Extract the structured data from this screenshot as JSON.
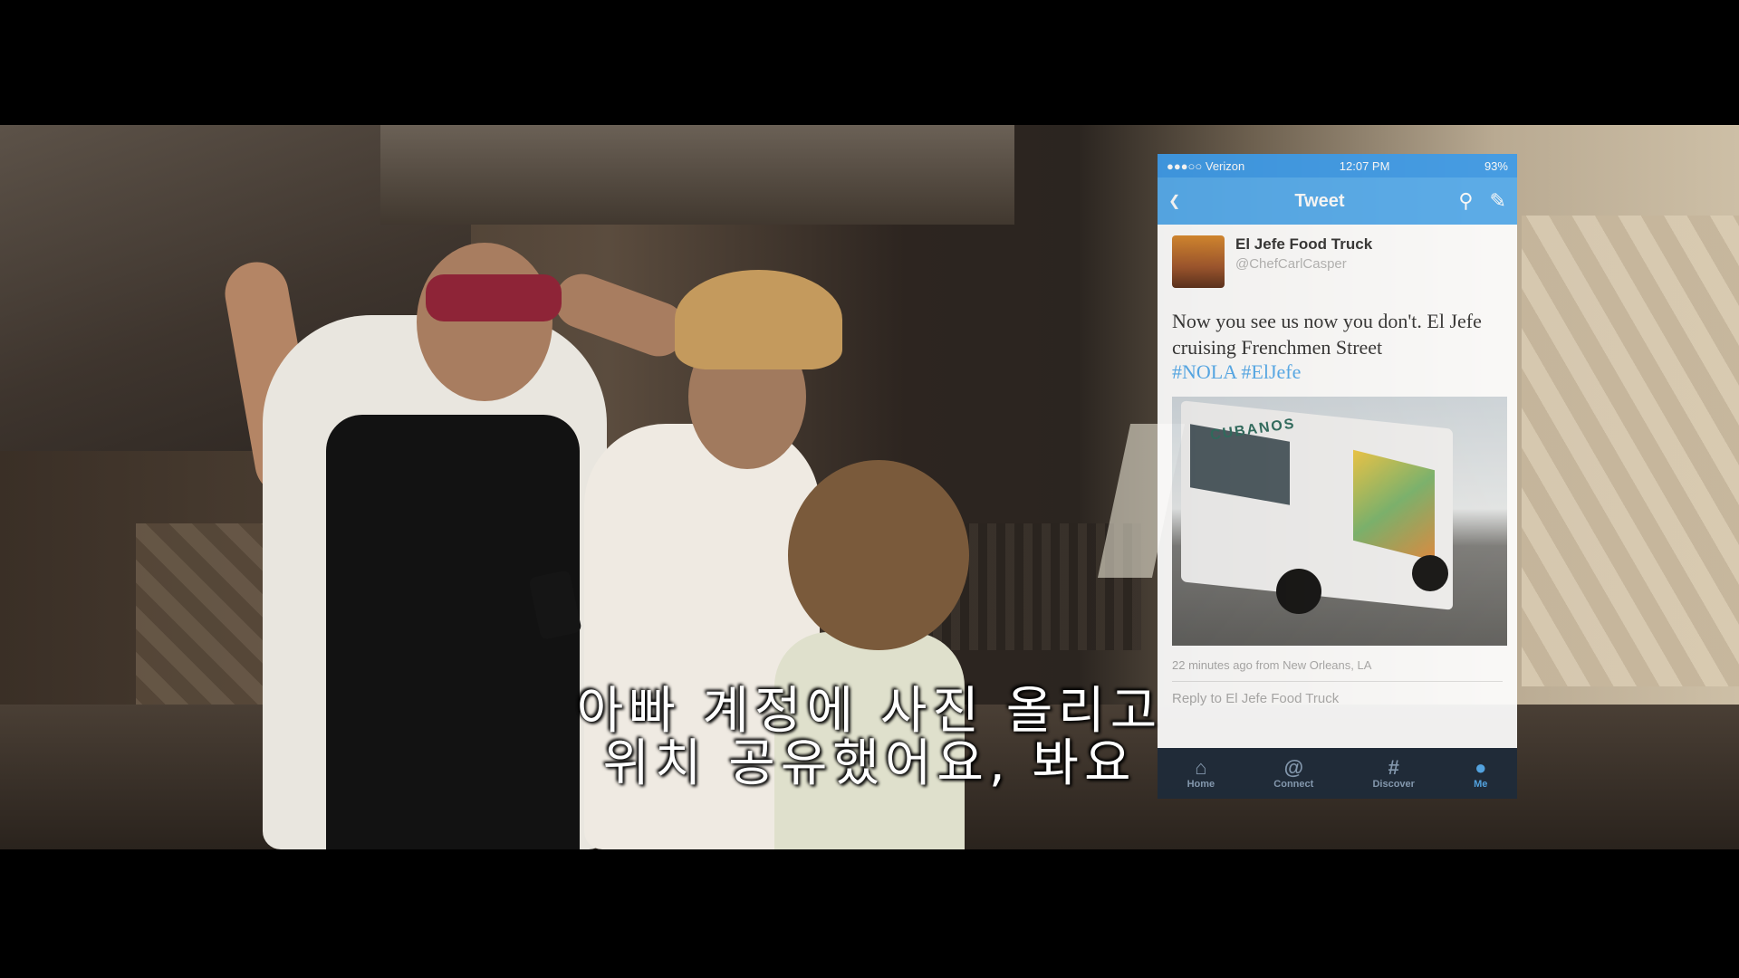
{
  "subtitle": {
    "line1": "아빠 계정에 사진 올리고",
    "line2": "위치 공유했어요, 봐요"
  },
  "twitter": {
    "status": {
      "carrier": "●●●○○ Verizon",
      "time": "12:07 PM",
      "battery": "93%"
    },
    "nav": {
      "title": "Tweet",
      "back_icon": "chevron-left",
      "search_icon": "search",
      "compose_icon": "compose"
    },
    "user": {
      "name": "El Jefe Food Truck",
      "handle": "@ChefCarlCasper"
    },
    "tweet_text": "Now you see us now you don't. El Jefe cruising Frenchmen Street",
    "hashtags": "#NOLA #ElJefe",
    "photo": {
      "truck_logo": "CUBANOS"
    },
    "meta": "22 minutes ago from New Orleans, LA",
    "reply_placeholder": "Reply to El Jefe Food Truck",
    "tabs": [
      {
        "label": "Home",
        "icon": "⌂"
      },
      {
        "label": "Connect",
        "icon": "@"
      },
      {
        "label": "Discover",
        "icon": "#"
      },
      {
        "label": "Me",
        "icon": "●"
      }
    ],
    "colors": {
      "header": "#55acee",
      "tabbar": "#1e2b3a"
    }
  }
}
